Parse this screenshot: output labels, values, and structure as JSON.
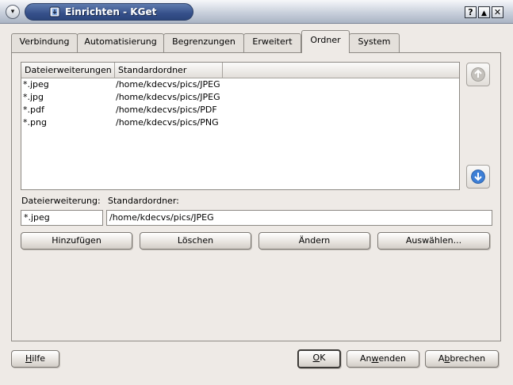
{
  "window": {
    "title": "Einrichten - KGet",
    "controls": {
      "help": "?",
      "shade": "▲",
      "close": "✕",
      "menu": "▾"
    }
  },
  "tabs": [
    {
      "label": "Verbindung",
      "active": false
    },
    {
      "label": "Automatisierung",
      "active": false
    },
    {
      "label": "Begrenzungen",
      "active": false
    },
    {
      "label": "Erweitert",
      "active": false
    },
    {
      "label": "Ordner",
      "active": true
    },
    {
      "label": "System",
      "active": false
    }
  ],
  "list": {
    "columns": [
      "Dateierweiterungen",
      "Standardordner"
    ],
    "rows": [
      {
        "ext": "*.jpeg",
        "folder": "/home/kdecvs/pics/JPEG"
      },
      {
        "ext": "*.jpg",
        "folder": "/home/kdecvs/pics/JPEG"
      },
      {
        "ext": "*.pdf",
        "folder": "/home/kdecvs/pics/PDF"
      },
      {
        "ext": "*.png",
        "folder": "/home/kdecvs/pics/PNG"
      }
    ]
  },
  "form": {
    "ext_label": "Dateierweiterung:",
    "folder_label": "Standardordner:",
    "ext_value": "*.jpeg",
    "folder_value": "/home/kdecvs/pics/JPEG"
  },
  "actions": {
    "add": "Hinzufügen",
    "delete": "Löschen",
    "change": "Ändern",
    "select": "Auswählen..."
  },
  "footer": {
    "help_mnemonic": "H",
    "help_rest": "ilfe",
    "ok_mnemonic": "O",
    "ok_rest": "K",
    "apply_pre": "An",
    "apply_mnemonic": "w",
    "apply_rest": "enden",
    "cancel_pre": "A",
    "cancel_mnemonic": "b",
    "cancel_rest": "brechen"
  },
  "colors": {
    "accent": "#36508a",
    "arrow_enabled": "#3d7fd6",
    "arrow_disabled": "#b8b5b0"
  }
}
